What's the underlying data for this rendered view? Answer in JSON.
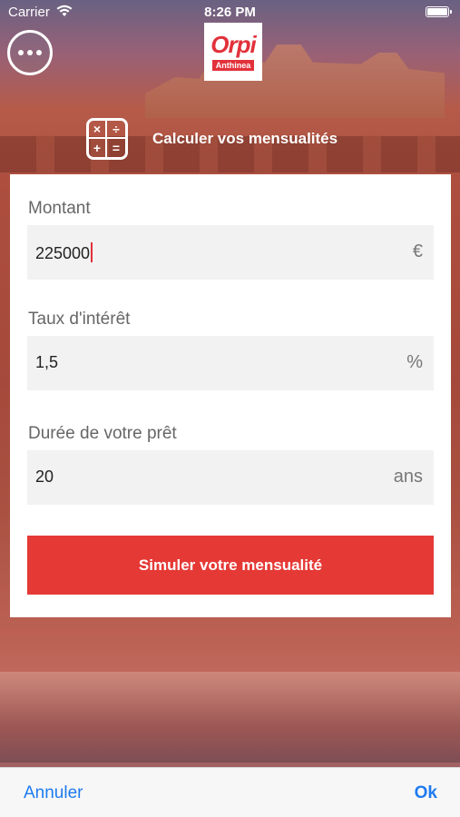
{
  "status_bar": {
    "carrier": "Carrier",
    "time": "8:26 PM"
  },
  "logo": {
    "brand": "Orpi",
    "subtitle": "Anthinea"
  },
  "header": {
    "title": "Calculer vos mensualités",
    "calc_symbols": [
      "×",
      "÷",
      "+",
      "="
    ]
  },
  "form": {
    "montant": {
      "label": "Montant",
      "value": "225000",
      "unit": "€"
    },
    "taux": {
      "label": "Taux d'intérêt",
      "value": "1,5",
      "unit": "%"
    },
    "duree": {
      "label": "Durée de votre prêt",
      "value": "20",
      "unit": "ans"
    },
    "submit_label": "Simuler votre mensualité"
  },
  "toolbar": {
    "cancel_label": "Annuler",
    "ok_label": "Ok"
  },
  "colors": {
    "accent": "#e53935",
    "link": "#1d7bf0"
  }
}
